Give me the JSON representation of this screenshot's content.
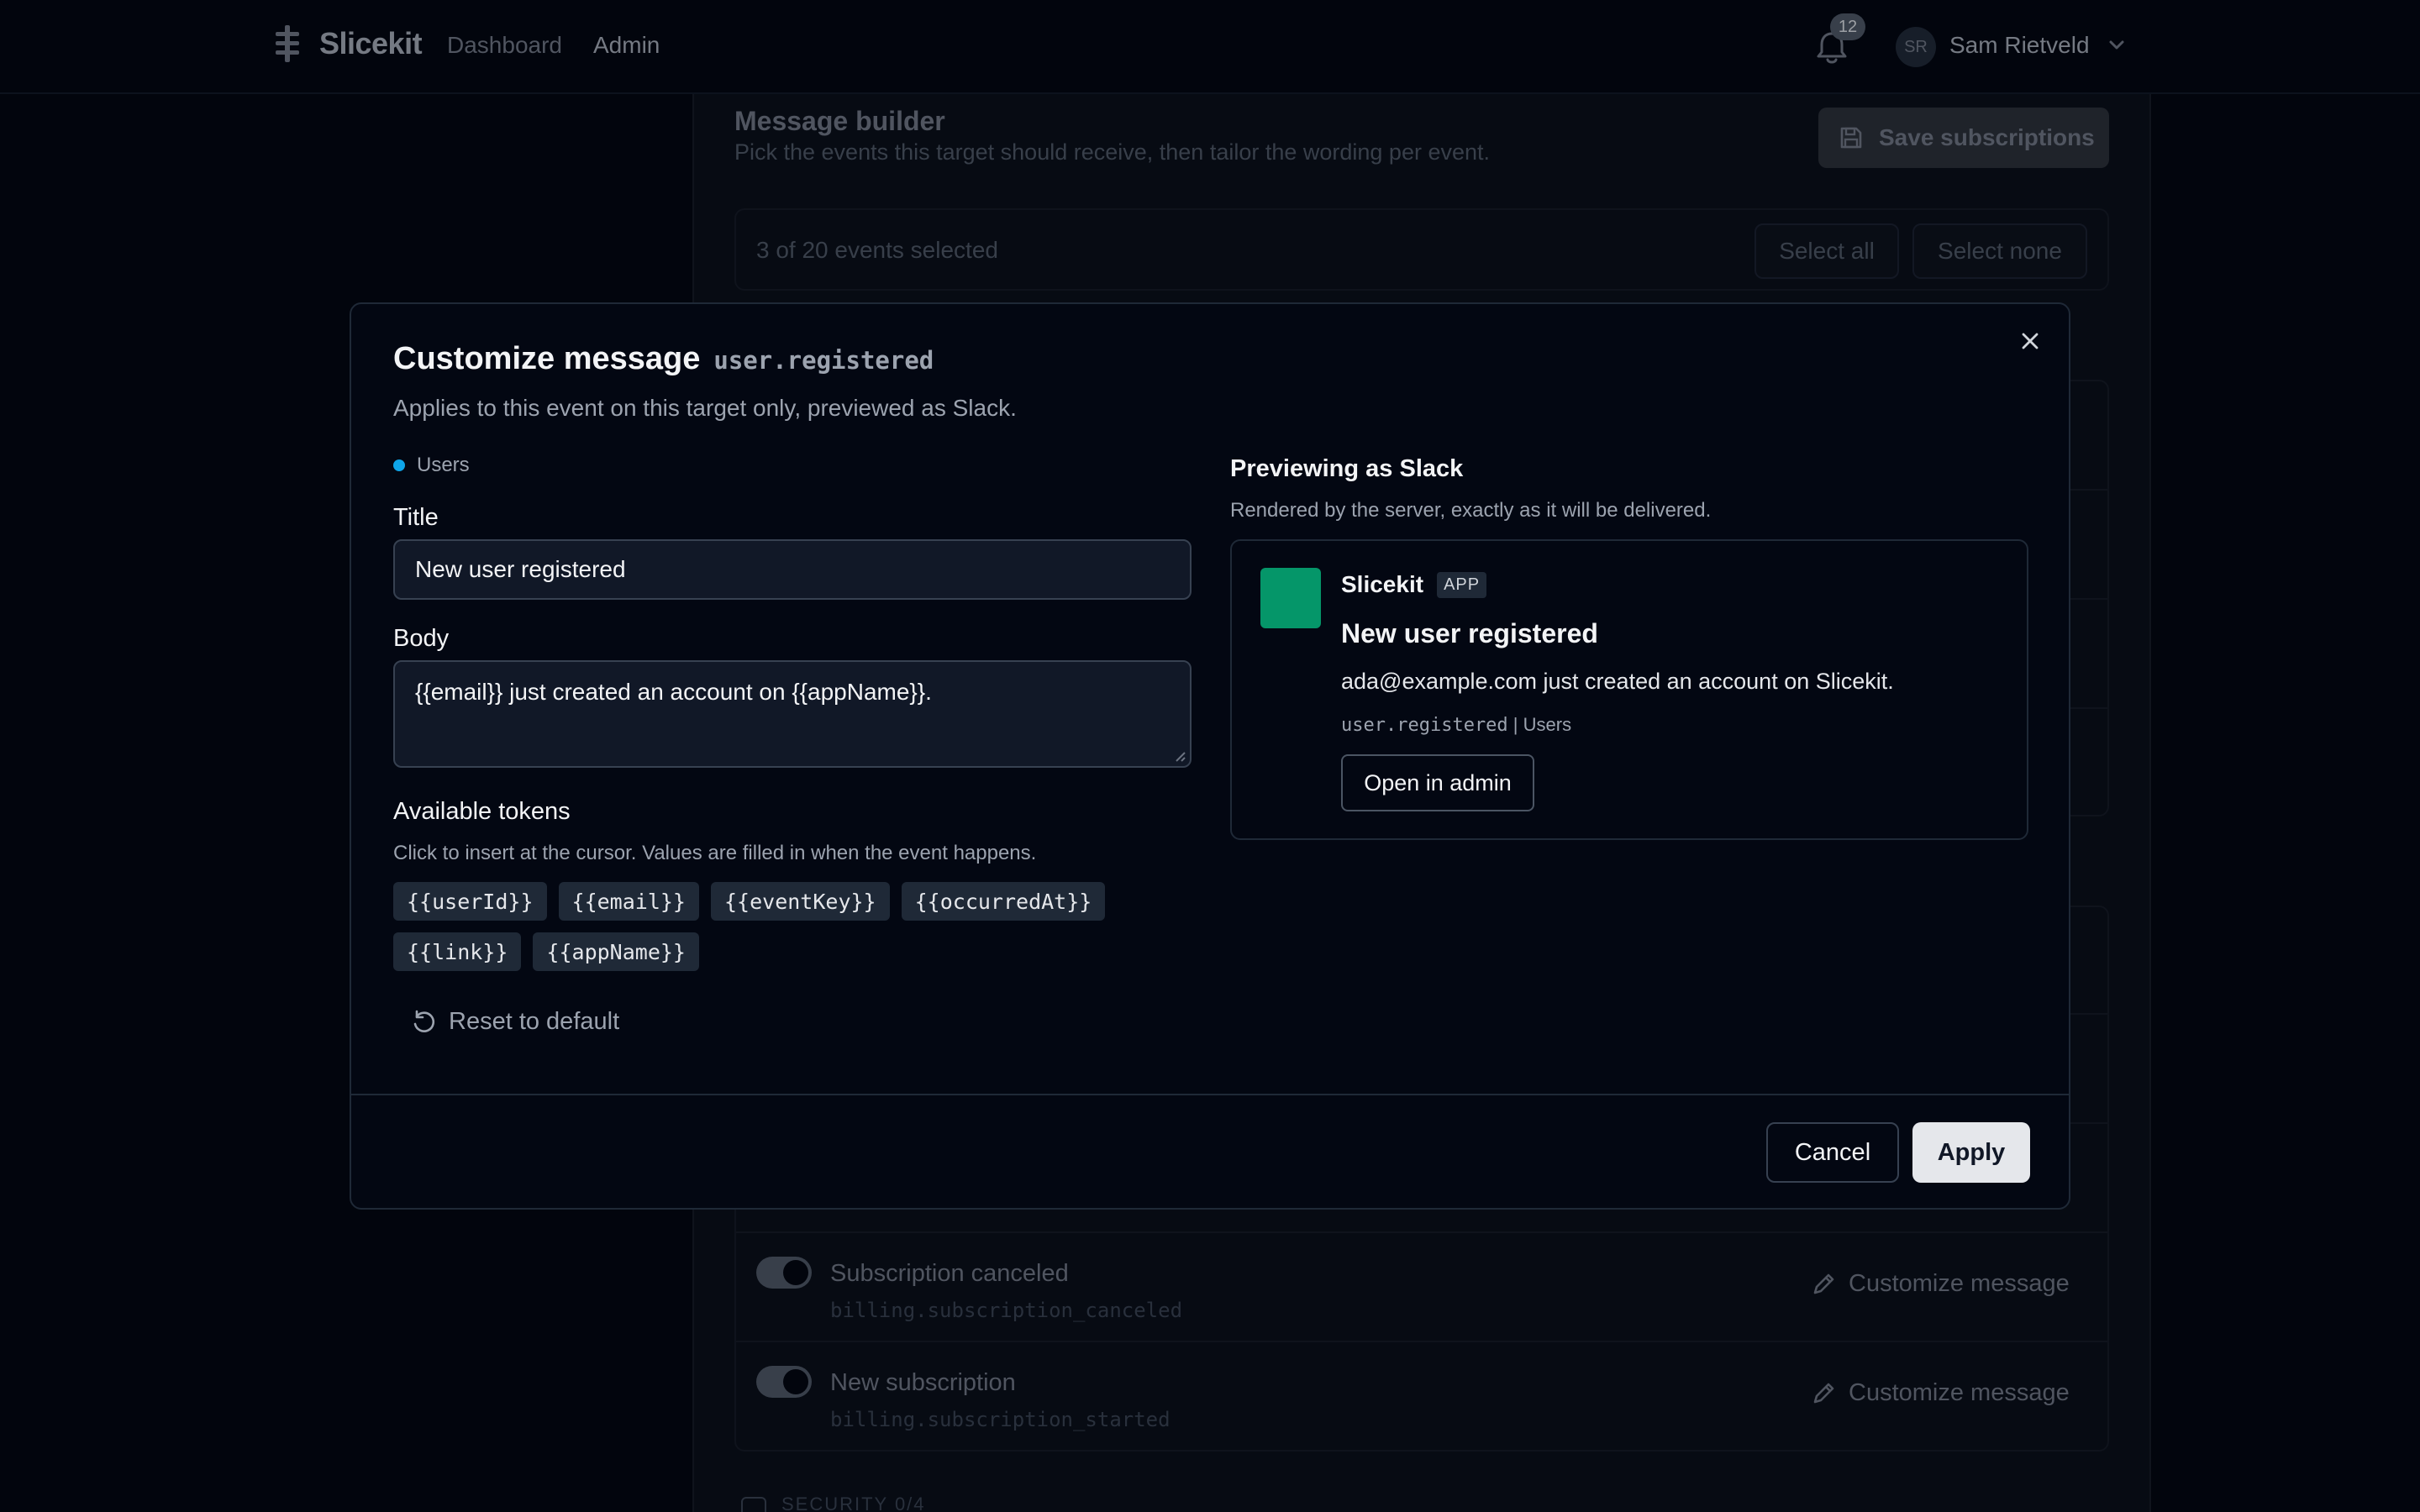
{
  "nav": {
    "brand": "Slicekit",
    "links": [
      "Dashboard",
      "Admin"
    ],
    "notifications_count": "12",
    "user_initials": "SR",
    "user_name": "Sam Rietveld"
  },
  "background": {
    "title": "Message builder",
    "subtitle": "Pick the events this target should receive, then tailor the wording per event.",
    "save_label": "Save subscriptions",
    "selection_count": "3 of 20 events selected",
    "select_all": "Select all",
    "select_none": "Select none",
    "rows": [
      {
        "name": "Subscription canceled",
        "key": "billing.subscription_canceled",
        "action": "Customize message",
        "enabled": true
      },
      {
        "name": "New subscription",
        "key": "billing.subscription_started",
        "action": "Customize message",
        "enabled": true
      }
    ],
    "next_group": "SECURITY  0/4"
  },
  "modal": {
    "title": "Customize message",
    "event_key": "user.registered",
    "description": "Applies to this event on this target only, previewed as Slack.",
    "group": "Users",
    "title_label": "Title",
    "title_value": "New user registered",
    "body_label": "Body",
    "body_value": "{{email}} just created an account on {{appName}}.",
    "tokens_label": "Available tokens",
    "tokens_help": "Click to insert at the cursor. Values are filled in when the event happens.",
    "tokens": [
      "{{userId}}",
      "{{email}}",
      "{{eventKey}}",
      "{{occurredAt}}",
      "{{link}}",
      "{{appName}}"
    ],
    "reset_label": "Reset to default",
    "cancel_label": "Cancel",
    "apply_label": "Apply",
    "preview": {
      "heading": "Previewing as Slack",
      "subheading": "Rendered by the server, exactly as it will be delivered.",
      "app_name": "Slicekit",
      "app_badge": "APP",
      "title": "New user registered",
      "body": "ada@example.com just created an account on Slicekit.",
      "context_key": "user.registered",
      "context_group": " | Users",
      "button": "Open in admin",
      "logo_color": "#059669"
    }
  },
  "colors": {
    "accent_dot": "#0ea5e9",
    "background": "#030712"
  }
}
